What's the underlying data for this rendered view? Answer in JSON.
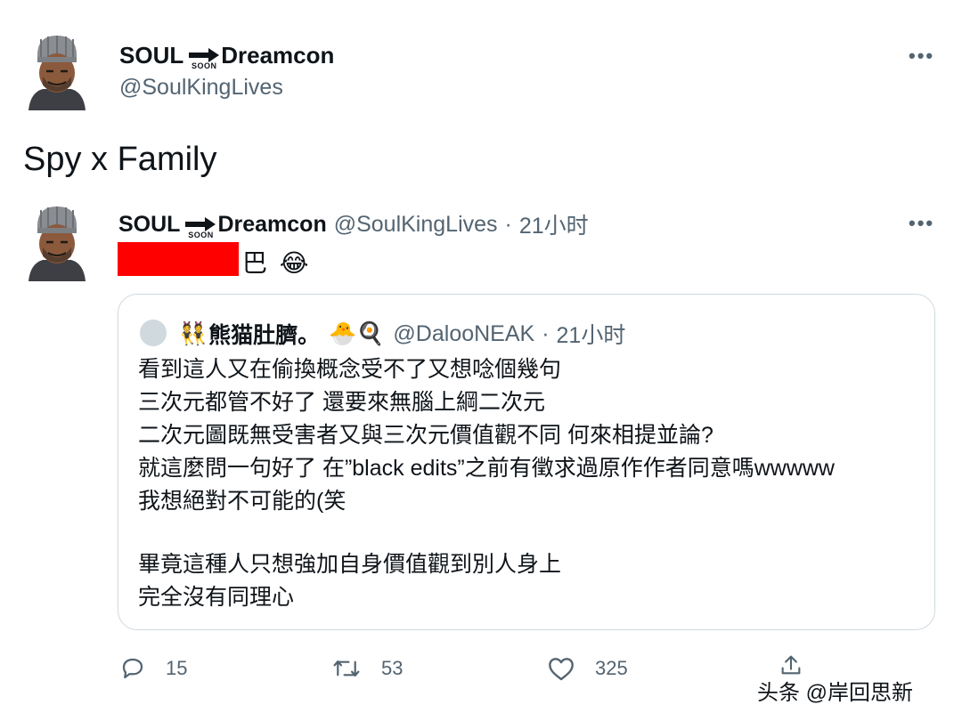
{
  "tweet": {
    "author_name_left": "SOUL",
    "author_name_right": "Dreamcon",
    "soon_label": "SOON",
    "handle": "@SoulKingLives",
    "more_label": "•••",
    "text": "Spy x Family"
  },
  "quoted": {
    "author_name_left": "SOUL",
    "author_name_right": "Dreamcon",
    "soon_label": "SOON",
    "handle": "@SoulKingLives",
    "dot": "·",
    "time": "21小时",
    "more_label": "•••",
    "text_suffix": "巴",
    "emoji": "😂"
  },
  "nested_quote": {
    "name_prefix_emoji": "👯",
    "name": "熊猫肚臍。",
    "name_suffix_emoji": "🐣🍳",
    "handle": "@DalooNEAK",
    "dot": "·",
    "time": "21小时",
    "lines": [
      "看到這人又在偷換概念受不了又想唸個幾句",
      "三次元都管不好了 還要來無腦上綱二次元",
      "二次元圖既無受害者又與三次元價值觀不同 何來相提並論?",
      "就這麼問一句好了 在”black edits”之前有徵求過原作作者同意嗎wwwww",
      "我想絕對不可能的(笑",
      "",
      "畢竟這種人只想強加自身價值觀到別人身上",
      "完全沒有同理心"
    ]
  },
  "actions": {
    "replies": "15",
    "retweets": "53",
    "likes": "325"
  },
  "watermark": "头条 @岸回思新",
  "colors": {
    "text": "#0f1419",
    "secondary": "#536471",
    "border": "#cfd9de",
    "redaction": "#ff0000"
  }
}
